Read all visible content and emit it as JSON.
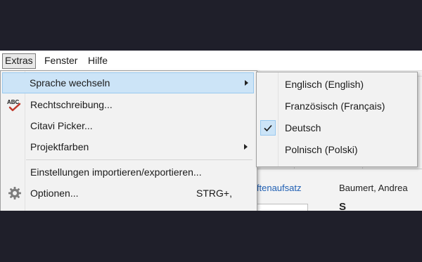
{
  "menubar": {
    "items": [
      "Extras",
      "Fenster",
      "Hilfe"
    ]
  },
  "menu": {
    "items": [
      {
        "label": "Sprache wechseln"
      },
      {
        "label": "Rechtschreibung..."
      },
      {
        "label": "Citavi Picker..."
      },
      {
        "label": "Projektfarben"
      },
      {
        "label": "Einstellungen importieren/exportieren..."
      },
      {
        "label": "Optionen...",
        "shortcut": "STRG+,"
      }
    ]
  },
  "submenu": {
    "items": [
      {
        "label": "Englisch (English)"
      },
      {
        "label": "Französisch (Français)"
      },
      {
        "label": "Deutsch",
        "checked": true
      },
      {
        "label": "Polnisch (Polski)"
      }
    ]
  },
  "background": {
    "link_text": "iftenaufsatz",
    "author_text": "Baumert, Andrea"
  },
  "icons": {
    "abc_label": "ABC",
    "spellcheck_color": "#c0392b",
    "check_color": "#1a1a1a"
  }
}
